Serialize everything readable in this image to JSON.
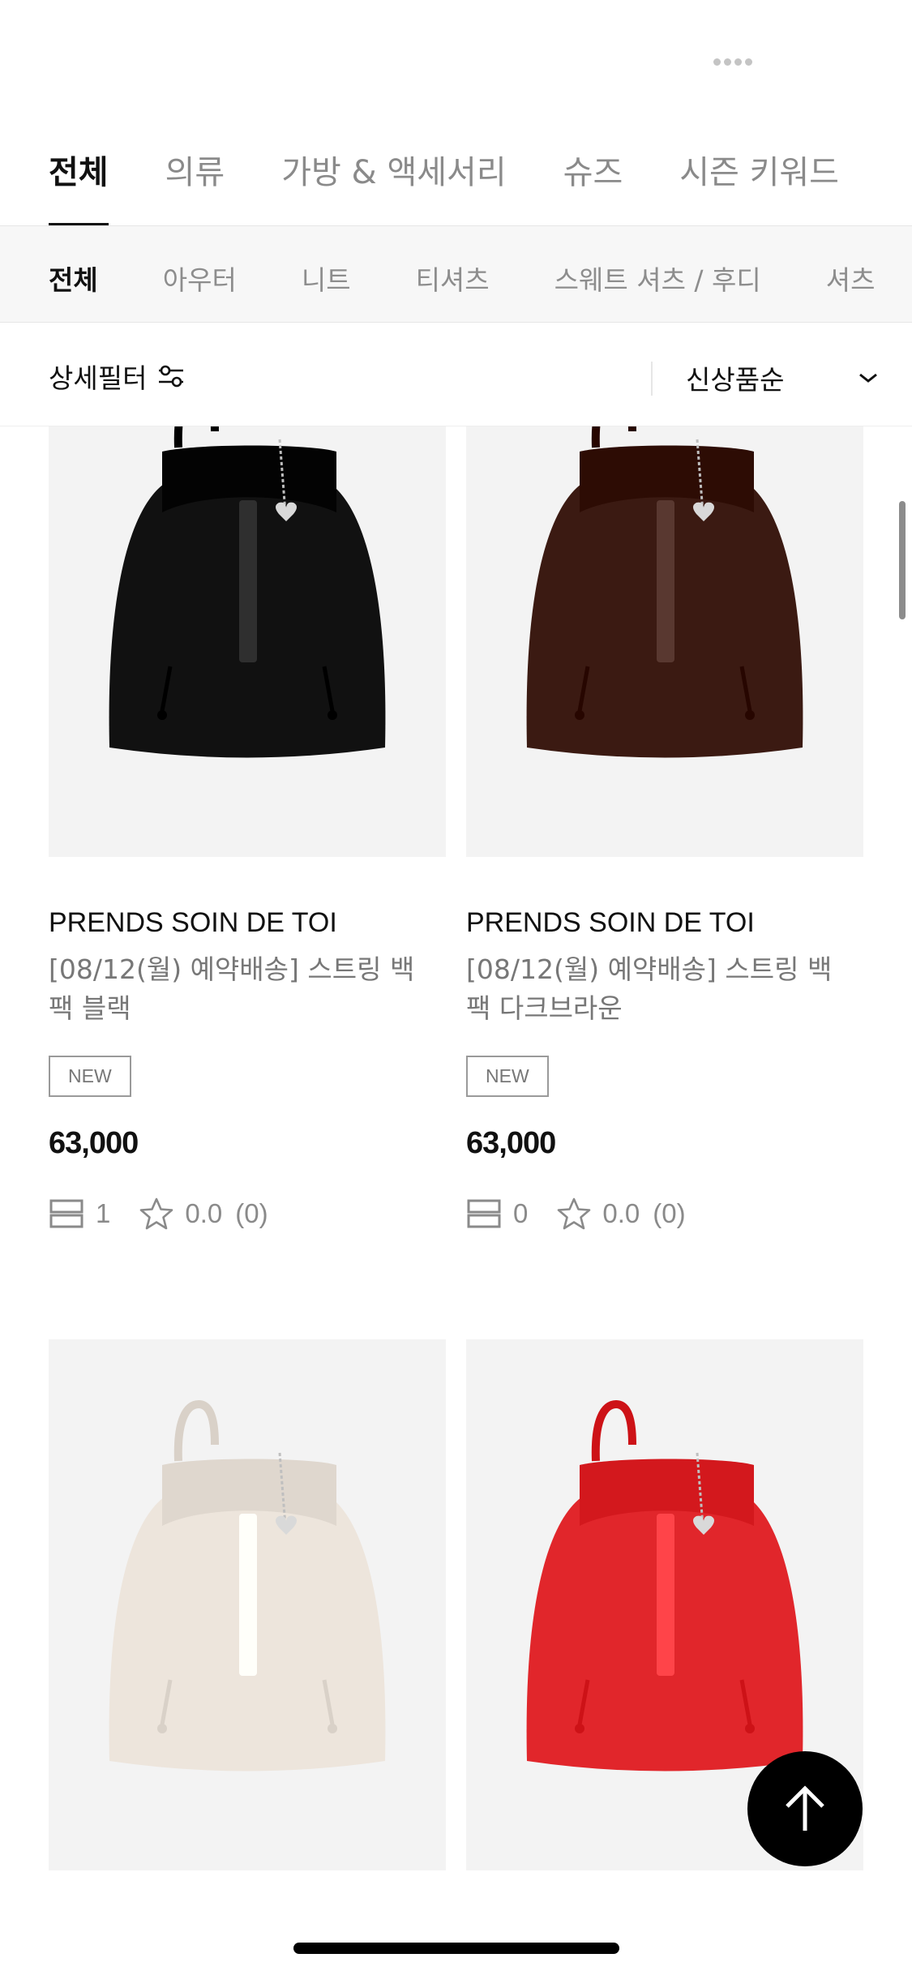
{
  "category_tabs": [
    "전체",
    "의류",
    "가방 & 액세서리",
    "슈즈",
    "시즌 키워드"
  ],
  "sub_tabs": [
    "전체",
    "아우터",
    "니트",
    "티셔츠",
    "스웨트 셔츠 / 후디",
    "셔츠"
  ],
  "filter": {
    "label": "상세필터",
    "sort_label": "신상품순"
  },
  "products": [
    {
      "brand": "PRENDS SOIN DE TOI",
      "name": "[08/12(월) 예약배송]  스트링 백팩 블랙",
      "badge": "NEW",
      "price": "63,000",
      "review_count": "1",
      "rating": "0.0",
      "rating_count": "(0)",
      "color": "#111111"
    },
    {
      "brand": "PRENDS SOIN DE TOI",
      "name": "[08/12(월) 예약배송]  스트링 백팩 다크브라운",
      "badge": "NEW",
      "price": "63,000",
      "review_count": "0",
      "rating": "0.0",
      "rating_count": "(0)",
      "color": "#3b1a12"
    },
    {
      "color": "#ede5dc"
    },
    {
      "color": "#e1262b"
    }
  ],
  "colors": {
    "active": "#111111",
    "inactive": "#8a8a8a",
    "image_bg": "#f3f3f3"
  }
}
